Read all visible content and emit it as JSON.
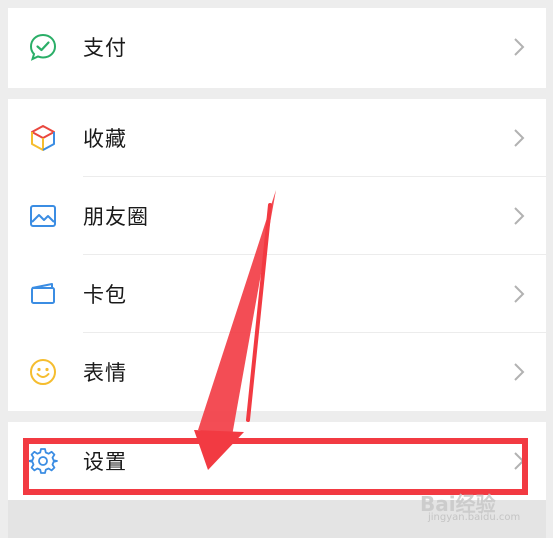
{
  "menu": {
    "pay": {
      "label": "支付",
      "icon": "pay-icon",
      "color": "#2aae67"
    },
    "favorites": {
      "label": "收藏",
      "icon": "favorites-cube-icon"
    },
    "moments": {
      "label": "朋友圈",
      "icon": "moments-photo-icon",
      "color": "#3b8de3"
    },
    "cards": {
      "label": "卡包",
      "icon": "card-wallet-icon",
      "color": "#3b8de3"
    },
    "stickers": {
      "label": "表情",
      "icon": "smiley-icon",
      "color": "#f5bd2f"
    },
    "settings": {
      "label": "设置",
      "icon": "gear-icon",
      "color": "#3b8de3"
    }
  },
  "annotation": {
    "highlight_color": "#f23a42"
  },
  "watermark": {
    "text": "Bai经验",
    "sub": "jingyan.baidu.com"
  }
}
